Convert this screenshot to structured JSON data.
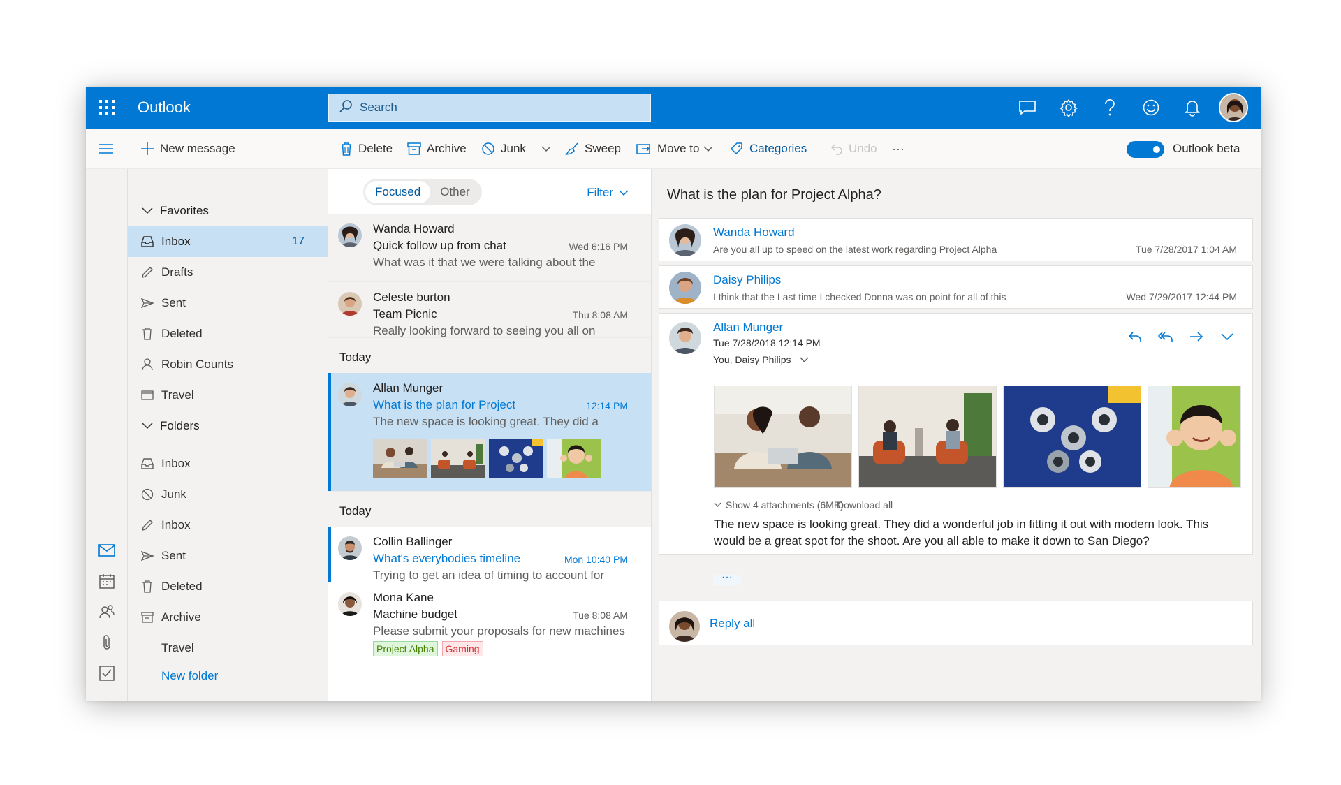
{
  "app": {
    "name": "Outlook"
  },
  "search": {
    "placeholder": "Search"
  },
  "topbar_icons": [
    "chat-icon",
    "settings-icon",
    "help-icon",
    "feedback-smiley-icon",
    "notifications-bell-icon"
  ],
  "commands": {
    "new_message": "New message",
    "delete": "Delete",
    "archive": "Archive",
    "junk": "Junk",
    "sweep": "Sweep",
    "move_to": "Move to",
    "categories": "Categories",
    "undo": "Undo",
    "more": "···",
    "beta_label": "Outlook beta",
    "beta_on": true
  },
  "folder_pane": {
    "favorites_label": "Favorites",
    "favorites": [
      {
        "label": "Inbox",
        "count": "17",
        "icon": "inbox-icon",
        "selected": true
      },
      {
        "label": "Drafts",
        "count": "",
        "icon": "pencil-icon"
      },
      {
        "label": "Sent",
        "count": "",
        "icon": "send-icon"
      },
      {
        "label": "Deleted",
        "count": "",
        "icon": "trash-icon"
      },
      {
        "label": "Robin Counts",
        "count": "",
        "icon": "person-icon"
      },
      {
        "label": "Travel",
        "count": "",
        "icon": "folder-icon"
      }
    ],
    "folders_label": "Folders",
    "folders": [
      {
        "label": "Inbox",
        "icon": "inbox-icon"
      },
      {
        "label": "Junk",
        "icon": "block-icon"
      },
      {
        "label": "Inbox",
        "icon": "pencil-icon"
      },
      {
        "label": "Sent",
        "icon": "send-icon"
      },
      {
        "label": "Deleted",
        "icon": "trash-icon"
      },
      {
        "label": "Archive",
        "icon": "archive-icon"
      },
      {
        "label": "Travel",
        "icon": ""
      }
    ],
    "new_folder": "New folder"
  },
  "message_list": {
    "pivot_focused": "Focused",
    "pivot_other": "Other",
    "filter": "Filter",
    "section_today_1": "Today",
    "section_today_2": "Today",
    "messages": [
      {
        "from": "Wanda Howard",
        "subject": "Quick follow up from chat",
        "time": "Wed 6:16 PM",
        "preview": "What was it that we were talking about the"
      },
      {
        "from": "Celeste burton",
        "subject": "Team Picnic",
        "time": "Thu 8:08 AM",
        "preview": "Really looking forward to seeing you all on"
      },
      {
        "from": "Allan Munger",
        "subject": "What is the plan for Project",
        "time": "12:14 PM",
        "preview": "The new space is looking great. They did a"
      },
      {
        "from": "Collin Ballinger",
        "subject": "What's everybodies timeline",
        "time": "Mon 10:40 PM",
        "preview": "Trying to get an idea of timing to account for"
      },
      {
        "from": "Mona Kane",
        "subject": "Machine budget",
        "time": "Tue 8:08 AM",
        "preview": "Please submit your proposals for new machines"
      }
    ],
    "tags": [
      {
        "label": "Project Alpha",
        "color": "#498205"
      },
      {
        "label": "Gaming",
        "color": "#d13438"
      }
    ]
  },
  "reading_pane": {
    "subject": "What is the plan for Project Alpha?",
    "thread": [
      {
        "sender": "Wanda Howard",
        "snippet": "Are you all up to speed on the latest work regarding Project Alpha",
        "date": "Tue 7/28/2017 1:04 AM"
      },
      {
        "sender": "Daisy Philips",
        "snippet": "I think that the Last time I checked Donna was on point for all of this",
        "date": "Wed 7/29/2017 12:44 PM"
      }
    ],
    "expanded": {
      "sender": "Allan Munger",
      "date": "Tue 7/28/2018 12:14 PM",
      "recipients": "You, Daisy Philips",
      "show_attachments": "Show 4 attachments (6MB)",
      "download_all": "Download all",
      "body_line1": "The new space is looking great. They did a wonderful job in fitting it out with modern look. This",
      "body_line2": "would be a great spot for the shoot. Are you all able to make it down to San Diego?",
      "more": "···"
    },
    "reply_all": "Reply all"
  },
  "colors": {
    "accent": "#0078d4",
    "selected": "#c7e0f4"
  }
}
